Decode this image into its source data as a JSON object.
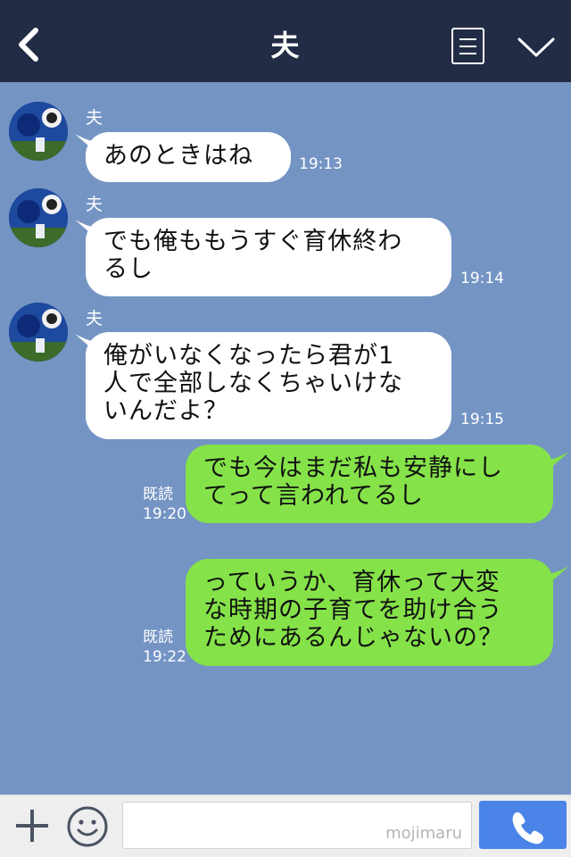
{
  "header": {
    "title": "夫"
  },
  "messages": [
    {
      "sender": "夫",
      "lines": [
        "あのときはね"
      ],
      "time": "19:13"
    },
    {
      "sender": "夫",
      "lines": [
        "でも俺ももうすぐ育休終わ",
        "るし"
      ],
      "time": "19:14"
    },
    {
      "sender": "夫",
      "lines": [
        "俺がいなくなったら君が1",
        "人で全部しなくちゃいけな",
        "いんだよ？"
      ],
      "time": "19:15"
    },
    {
      "lines": [
        "でも今はまだ私も安静にし",
        "てって言われてるし"
      ],
      "read": "既読",
      "time": "19:20"
    },
    {
      "lines": [
        "っていうか、育休って大変",
        "な時期の子育てを助け合う",
        "ためにあるんじゃないの？"
      ],
      "read": "既読",
      "time": "19:22"
    }
  ],
  "footer": {
    "input_placeholder": "",
    "watermark": "mojimaru"
  },
  "colors": {
    "header_bg": "#232c45",
    "chat_bg": "#7494c4",
    "incoming_bubble": "#ffffff",
    "outgoing_bubble": "#85e249",
    "send_button": "#4a84e8"
  }
}
